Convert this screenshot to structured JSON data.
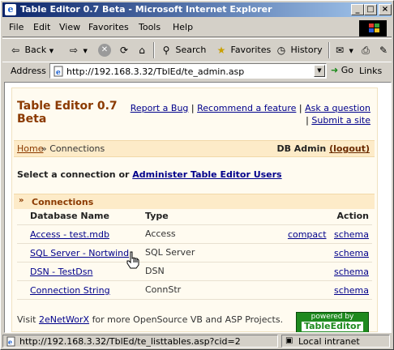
{
  "window": {
    "title": "Table Editor 0.7 Beta - Microsoft Internet Explorer",
    "min": "_",
    "max": "□",
    "close": "×"
  },
  "menu": [
    "File",
    "Edit",
    "View",
    "Favorites",
    "Tools",
    "Help"
  ],
  "toolbar": {
    "back": "Back",
    "search": "Search",
    "favorites": "Favorites",
    "history": "History"
  },
  "address": {
    "label": "Address",
    "url": "http://192.168.3.32/TblEd/te_admin.asp",
    "go": "Go",
    "links": "Links"
  },
  "app": {
    "title": "Table Editor 0.7 Beta",
    "links": {
      "report_bug": "Report a Bug",
      "recommend": "Recommend a feature",
      "ask": "Ask a question",
      "submit": "Submit a site"
    },
    "breadcrumb": {
      "home": "Home",
      "separator": "»",
      "current": "Connections"
    },
    "user": {
      "name": "DB Admin",
      "logout": "(logout)"
    },
    "select_text": "Select a connection or",
    "admin_link": "Administer Table Editor Users",
    "section": {
      "arrow": "»",
      "title": "Connections"
    },
    "table": {
      "headers": {
        "name": "Database Name",
        "type": "Type",
        "action": "Action"
      },
      "rows": [
        {
          "name": "Access - test.mdb",
          "type": "Access",
          "compact": "compact",
          "schema": "schema"
        },
        {
          "name": "SQL Server - Nortwind",
          "type": "SQL Server",
          "compact": "",
          "schema": "schema"
        },
        {
          "name": "DSN - TestDsn",
          "type": "DSN",
          "compact": "",
          "schema": "schema"
        },
        {
          "name": "Connection String",
          "type": "ConnStr",
          "compact": "",
          "schema": "schema"
        }
      ]
    },
    "footer": {
      "visit": "Visit",
      "link": "2eNetWorX",
      "rest": "for more OpenSource VB and ASP Projects."
    },
    "powered": {
      "line1": "powered by",
      "line2": "TableEditor"
    }
  },
  "status": {
    "url": "http://192.168.3.32/TblEd/te_listtables.asp?cid=2",
    "zone": "Local intranet"
  }
}
